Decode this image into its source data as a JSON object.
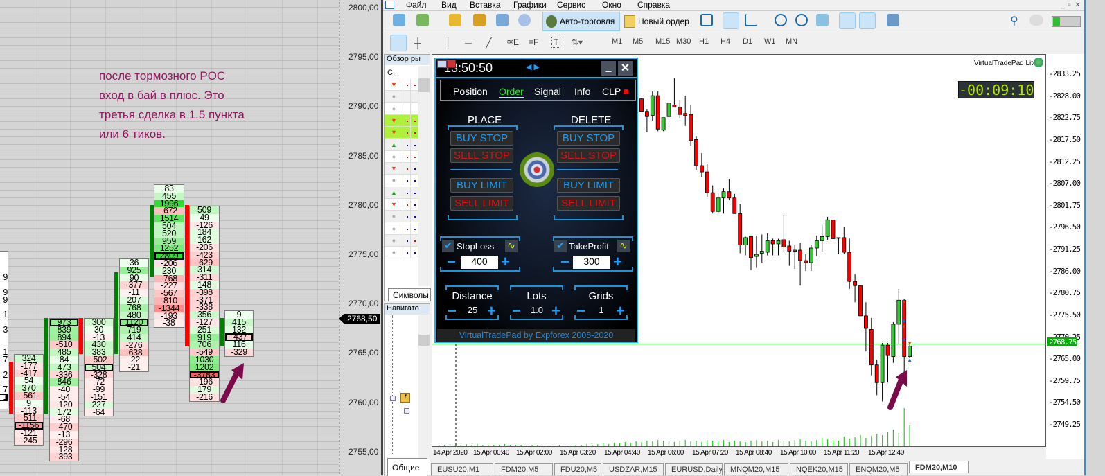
{
  "annotation": {
    "lines": [
      "после тормозного POC",
      "вход в бай в плюс. Это",
      "третья сделка в 1.5 пункта",
      "или 6 тиков."
    ],
    "color": "#8b1a5e"
  },
  "footprint": {
    "price_axis": [
      {
        "price": 2800,
        "label": "2800,00"
      },
      {
        "price": 2795,
        "label": "2795,00"
      },
      {
        "price": 2790,
        "label": "2790,00"
      },
      {
        "price": 2785,
        "label": "2785,00"
      },
      {
        "price": 2780,
        "label": "2780,00"
      },
      {
        "price": 2775,
        "label": "2775,00"
      },
      {
        "price": 2770,
        "label": "2770,00"
      },
      {
        "price": 2765,
        "label": "2765,00"
      },
      {
        "price": 2760,
        "label": "2760,00"
      },
      {
        "price": 2755,
        "label": "2755,00"
      }
    ],
    "current_price": {
      "price": 2768.5,
      "label": "2768,50"
    },
    "columns": [
      {
        "bar": "none",
        "poc": 19,
        "values": [
          "",
          "",
          "",
          "9",
          "",
          "9",
          "9",
          "",
          "1",
          "",
          "3",
          "",
          "",
          "1",
          "7",
          "",
          "2",
          "",
          "7",
          "1",
          ""
        ]
      },
      {
        "bar": "down",
        "poc": 9,
        "values": [
          324,
          -177,
          -417,
          54,
          370,
          -561,
          9,
          -113,
          -511,
          -1156,
          -121,
          -245
        ]
      },
      {
        "bar": "up",
        "poc": 0,
        "values": [
          973,
          839,
          894,
          -510,
          485,
          84,
          473,
          -336,
          846,
          -40,
          -54,
          -120,
          172,
          -68,
          -470,
          -13,
          -296,
          -128,
          -393
        ]
      },
      {
        "bar": "down",
        "poc": 6,
        "values": [
          300,
          30,
          -13,
          430,
          383,
          -502,
          504,
          -328,
          -72,
          -99,
          -151,
          227,
          -64
        ]
      },
      {
        "bar": "up",
        "poc": 8,
        "values": [
          36,
          925,
          90,
          -377,
          -11,
          207,
          768,
          480,
          1120,
          719,
          414,
          -276,
          -638,
          -22,
          -21
        ]
      },
      {
        "bar": "up",
        "poc": 9,
        "values": [
          83,
          455,
          1996,
          -672,
          1514,
          504,
          520,
          959,
          1252,
          2809,
          -206,
          230,
          -768,
          -227,
          -567,
          -810,
          -1344,
          -193,
          -38
        ]
      },
      {
        "bar": "down",
        "poc": 22,
        "values": [
          509,
          49,
          -126,
          184,
          162,
          -206,
          -423,
          -629,
          314,
          -311,
          148,
          -398,
          -371,
          -338,
          356,
          -127,
          251,
          919,
          706,
          -549,
          1030,
          1202,
          -3783,
          -196,
          179,
          -216
        ]
      },
      {
        "bar": "up",
        "poc": 3,
        "values": [
          9,
          415,
          132,
          -437,
          116,
          -329
        ]
      }
    ],
    "colors": {
      "up": "#008000",
      "down": "#ff0000"
    }
  },
  "menu": [
    "Файл",
    "Вид",
    "Вставка",
    "Графики",
    "Сервис",
    "Окно",
    "Справка"
  ],
  "toolbar": {
    "auto_trading": "Авто-торговля",
    "new_order": "Новый ордер",
    "timeframes": [
      "M1",
      "M5",
      "M15",
      "M30",
      "H1",
      "H4",
      "D1",
      "W1",
      "MN"
    ]
  },
  "market_watch": {
    "title": "Обзор ры",
    "header": "С.",
    "tab": "Символы",
    "rows": [
      {
        "signal": "down",
        "dots": [
          "red",
          "red"
        ]
      },
      {
        "signal": "neutral",
        "dots": [
          "",
          ""
        ]
      },
      {
        "signal": "neutral",
        "dots": [
          "",
          ""
        ]
      },
      {
        "signal": "down",
        "dots": [
          "red",
          "red"
        ],
        "highlight": true
      },
      {
        "signal": "down",
        "dots": [
          "red",
          "red"
        ],
        "highlight": true
      },
      {
        "signal": "up",
        "dots": [
          "blue",
          "blue"
        ]
      },
      {
        "signal": "neutral",
        "dots": [
          "red",
          "red"
        ]
      },
      {
        "signal": "down",
        "dots": [
          "red",
          "blue"
        ]
      },
      {
        "signal": "neutral",
        "dots": [
          "blue",
          "blue"
        ]
      },
      {
        "signal": "up",
        "dots": [
          "blue",
          "blue"
        ]
      },
      {
        "signal": "down",
        "dots": [
          "red",
          "blue"
        ]
      },
      {
        "signal": "neutral",
        "dots": [
          "blue",
          "blue"
        ]
      },
      {
        "signal": "neutral",
        "dots": [
          "blue",
          "blue"
        ]
      },
      {
        "signal": "neutral",
        "dots": [
          "blue",
          "red"
        ]
      },
      {
        "signal": "neutral",
        "dots": [
          "blue",
          "blue"
        ]
      }
    ]
  },
  "navigator": {
    "title": "Навигато",
    "tab": "Общие"
  },
  "vtp": {
    "clock": "13:50:50",
    "tabs": [
      "Position",
      "Order",
      "Signal",
      "Info",
      "CLP"
    ],
    "active_tab": "Order",
    "place": "PLACE",
    "delete": "DELETE",
    "buttons": [
      "BUY STOP",
      "SELL STOP",
      "BUY LIMIT",
      "SELL LIMIT"
    ],
    "stoploss": {
      "label": "StopLoss",
      "value": "400",
      "checked": true
    },
    "takeprofit": {
      "label": "TakeProfit",
      "value": "300",
      "checked": true
    },
    "distance": {
      "label": "Distance",
      "value": "25"
    },
    "lots": {
      "label": "Lots",
      "value": "1.0"
    },
    "grids": {
      "label": "Grids",
      "value": "1"
    },
    "footer": "VirtualTradePad by Expforex 2008-2020",
    "colors": {
      "border": "#16b4f0",
      "buy": "#1a9cf0",
      "sell": "#e01010",
      "active_tab": "#22ee22"
    }
  },
  "chart": {
    "indicator_label": "VirtualTradePad  Lite",
    "timer": "-00:09:10",
    "price_axis": [
      "2833.25",
      "2828.00",
      "2822.75",
      "2817.50",
      "2812.25",
      "2807.00",
      "2801.75",
      "2796.50",
      "2791.25",
      "2786.00",
      "2780.75",
      "2775.50",
      "2770.25",
      "2765.00",
      "2759.75",
      "2754.50",
      "2749.25"
    ],
    "current_price": "2768.75",
    "time_axis": [
      "14 Apr 2020",
      "15 Apr 00:40",
      "15 Apr 02:00",
      "15 Apr 03:20",
      "15 Apr 04:40",
      "15 Apr 06:00",
      "15 Apr 07:20",
      "15 Apr 08:40",
      "15 Apr 10:00",
      "15 Apr 11:20",
      "15 Apr 12:40"
    ],
    "colors": {
      "bull": "#32cd32",
      "bear": "#ff0000",
      "volume": "#22cc22",
      "price_line": "#00b000"
    }
  },
  "chart_data": {
    "type": "candlestick",
    "ylim": [
      2749.25,
      2833.25
    ],
    "ohlc": [
      [
        2827.5,
        2827.75,
        2824.5,
        2824.5
      ],
      [
        2824.5,
        2825,
        2819.5,
        2823.25
      ],
      [
        2823.5,
        2829.25,
        2822.25,
        2828.25
      ],
      [
        2828.25,
        2829.25,
        2819.75,
        2820.25
      ],
      [
        2820,
        2823,
        2819.75,
        2823
      ],
      [
        2823.25,
        2826.5,
        2821.75,
        2826.5
      ],
      [
        2826,
        2832.5,
        2825.5,
        2825.5
      ],
      [
        2825.5,
        2827.25,
        2822.75,
        2823.75
      ],
      [
        2824,
        2828.25,
        2821,
        2823.5
      ],
      [
        2823.75,
        2826,
        2816.25,
        2817.5
      ],
      [
        2817.75,
        2818.5,
        2810.5,
        2811.5
      ],
      [
        2811.5,
        2814.5,
        2808.75,
        2810
      ],
      [
        2810,
        2812,
        2804,
        2805
      ],
      [
        2805,
        2806.75,
        2800,
        2800.5
      ],
      [
        2800.5,
        2805,
        2800,
        2803.75
      ],
      [
        2803.75,
        2806,
        2800,
        2805.25
      ],
      [
        2805.25,
        2808.25,
        2803.25,
        2803.75
      ],
      [
        2803.75,
        2804.75,
        2800,
        2800
      ],
      [
        2800,
        2802.25,
        2790.5,
        2792.5
      ],
      [
        2792.5,
        2794.5,
        2790,
        2794.25
      ],
      [
        2794.5,
        2794.75,
        2786.5,
        2789.5
      ],
      [
        2789.75,
        2794.75,
        2787,
        2790.25
      ],
      [
        2790.5,
        2795,
        2788.25,
        2791
      ],
      [
        2790.75,
        2795.25,
        2790,
        2793.5
      ],
      [
        2793.5,
        2794,
        2790,
        2792.75
      ],
      [
        2792.75,
        2794,
        2790,
        2793.5
      ],
      [
        2793.75,
        2799.5,
        2790.75,
        2792
      ],
      [
        2792.25,
        2793.5,
        2787.5,
        2791
      ],
      [
        2791,
        2792.5,
        2786.75,
        2791.25
      ],
      [
        2791.25,
        2793,
        2782.75,
        2788.75
      ],
      [
        2788.75,
        2790.25,
        2786.25,
        2788.25
      ],
      [
        2788.25,
        2792.5,
        2786.25,
        2791.75
      ],
      [
        2791.75,
        2794.75,
        2789.75,
        2793.5
      ],
      [
        2793.5,
        2797.25,
        2790.75,
        2794.5
      ],
      [
        2794.5,
        2799.25,
        2793.75,
        2798.5
      ],
      [
        2798.5,
        2798.5,
        2794,
        2794
      ],
      [
        2794.25,
        2794.25,
        2790.25,
        2794.25
      ],
      [
        2794.25,
        2796.75,
        2790.25,
        2790.75
      ],
      [
        2790.75,
        2794,
        2782,
        2783.75
      ],
      [
        2783.75,
        2785.5,
        2778.75,
        2782.75
      ],
      [
        2782.75,
        2782.75,
        2775.5,
        2775.5
      ],
      [
        2775.5,
        2778.75,
        2767,
        2772.5
      ],
      [
        2772.25,
        2775,
        2761.25,
        2763.75
      ],
      [
        2763.75,
        2765,
        2756.5,
        2759.5
      ],
      [
        2759.5,
        2769,
        2755,
        2768.5
      ],
      [
        2768.5,
        2769,
        2759.5,
        2766
      ],
      [
        2765.75,
        2774,
        2764.25,
        2773.5
      ],
      [
        2773.5,
        2782,
        2768.75,
        2779.25
      ],
      [
        2779.25,
        2779.5,
        2761.5,
        2765.75
      ],
      [
        2765.75,
        2769,
        2765.5,
        2768.25
      ]
    ],
    "volume": [
      2,
      2,
      3,
      2,
      2,
      3,
      2,
      3,
      2,
      2,
      2,
      2,
      3,
      2,
      2,
      2,
      1,
      2,
      2,
      1,
      1,
      1,
      2,
      1,
      1,
      2,
      2,
      3,
      2,
      3,
      4,
      3,
      5,
      4,
      6,
      5,
      7,
      6,
      8,
      7,
      9,
      8,
      7,
      6,
      8,
      9,
      7,
      8,
      6,
      9,
      8,
      7,
      9,
      6,
      8,
      7,
      6,
      8,
      9,
      7,
      8,
      6,
      9,
      8,
      7,
      9,
      10,
      8,
      7,
      9,
      12,
      10,
      9,
      8,
      14,
      11,
      13,
      16,
      12,
      15,
      18,
      16,
      20,
      24,
      19,
      55,
      30
    ]
  },
  "chart_tabs": [
    "EUSU20,M1",
    "FDM20,M5",
    "FDU20,M5",
    "USDZAR,M15",
    "EURUSD,Daily",
    "MNQM20,M15",
    "NQEK20,M15",
    "ENQM20,M5",
    "FDM20,M10"
  ],
  "active_chart_tab": "FDM20,M10"
}
